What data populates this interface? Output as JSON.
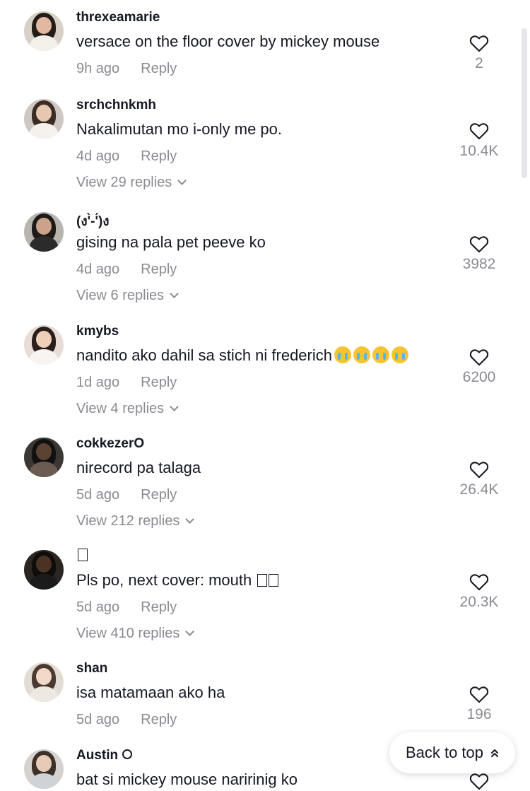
{
  "comments": [
    {
      "username": "threxeamarie",
      "text": "versace on the floor cover by mickey mouse",
      "time": "9h ago",
      "reply": "Reply",
      "likes": "2",
      "replies": ""
    },
    {
      "username": "srchchnkmh",
      "text": "Nakalimutan mo i-only me po.",
      "time": "4d ago",
      "reply": "Reply",
      "likes": "10.4K",
      "replies": "View 29 replies"
    },
    {
      "username": "(ง'̀-'́)ง",
      "text": "gising na pala pet peeve ko",
      "time": "4d ago",
      "reply": "Reply",
      "likes": "3982",
      "replies": "View 6 replies"
    },
    {
      "username": "kmybs",
      "text": "nandito ako dahil sa stich ni frederich",
      "time": "1d ago",
      "reply": "Reply",
      "likes": "6200",
      "replies": "View 4 replies"
    },
    {
      "username": "cokkezerO",
      "text": "nirecord pa talaga",
      "time": "5d ago",
      "reply": "Reply",
      "likes": "26.4K",
      "replies": "View 212 replies"
    },
    {
      "username": "",
      "text": "Pls po, next cover: mouth",
      "time": "5d ago",
      "reply": "Reply",
      "likes": "20.3K",
      "replies": "View 410 replies"
    },
    {
      "username": "shan",
      "text": "isa matamaan ako ha",
      "time": "5d ago",
      "reply": "Reply",
      "likes": "196",
      "replies": ""
    },
    {
      "username": "Austin",
      "text": "bat si mickey mouse naririnig ko",
      "time": "",
      "reply": "",
      "likes": "",
      "replies": ""
    }
  ],
  "back_to_top": "Back to top",
  "icons": {
    "like": "heart-icon",
    "expand": "chevron-down-icon",
    "back_to_top": "double-chevron-up-icon",
    "verified": "verified-badge-icon"
  },
  "colors": {
    "text": "#161823",
    "muted": "#8a8b91"
  }
}
